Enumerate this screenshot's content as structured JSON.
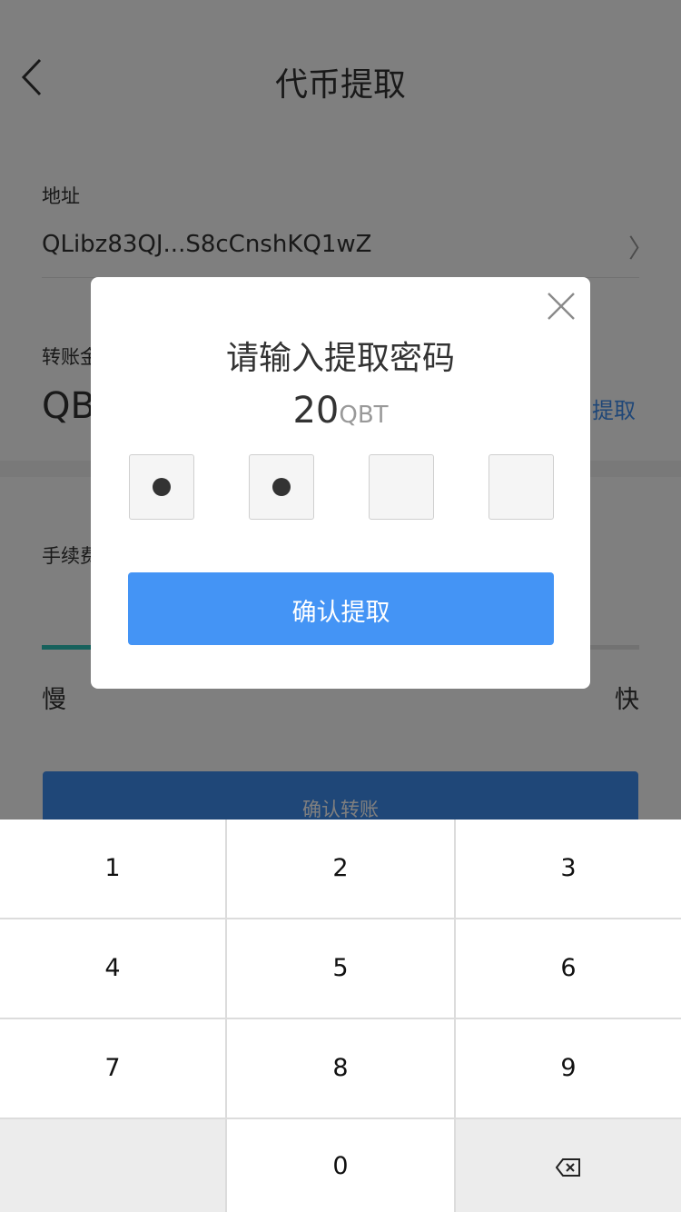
{
  "nav": {
    "title": "代币提取"
  },
  "address": {
    "label": "地址",
    "value": "QLibz83QJ...S8cCnshKQ1wZ",
    "arrow": "〉"
  },
  "amount": {
    "label": "转账金",
    "value": "QB",
    "withdraw_link": "提取"
  },
  "fee": {
    "label": "手续费",
    "slow": "慢",
    "fast": "快",
    "level": 0.1
  },
  "confirm_transfer_label": "确认转账",
  "dialog": {
    "title": "请输入提取密码",
    "amount": "20",
    "unit": "QBT",
    "pin_filled": 2,
    "pin_length": 4,
    "confirm_label": "确认提取"
  },
  "keypad": {
    "keys": [
      "1",
      "2",
      "3",
      "4",
      "5",
      "6",
      "7",
      "8",
      "9",
      "",
      "0",
      "backspace"
    ]
  },
  "colors": {
    "primary": "#4494f5",
    "slider": "#2ec2b8",
    "text": "#333333",
    "muted": "#999999"
  },
  "icons": {
    "back": "chevron-left-icon",
    "close": "close-icon",
    "backspace": "backspace-icon"
  }
}
